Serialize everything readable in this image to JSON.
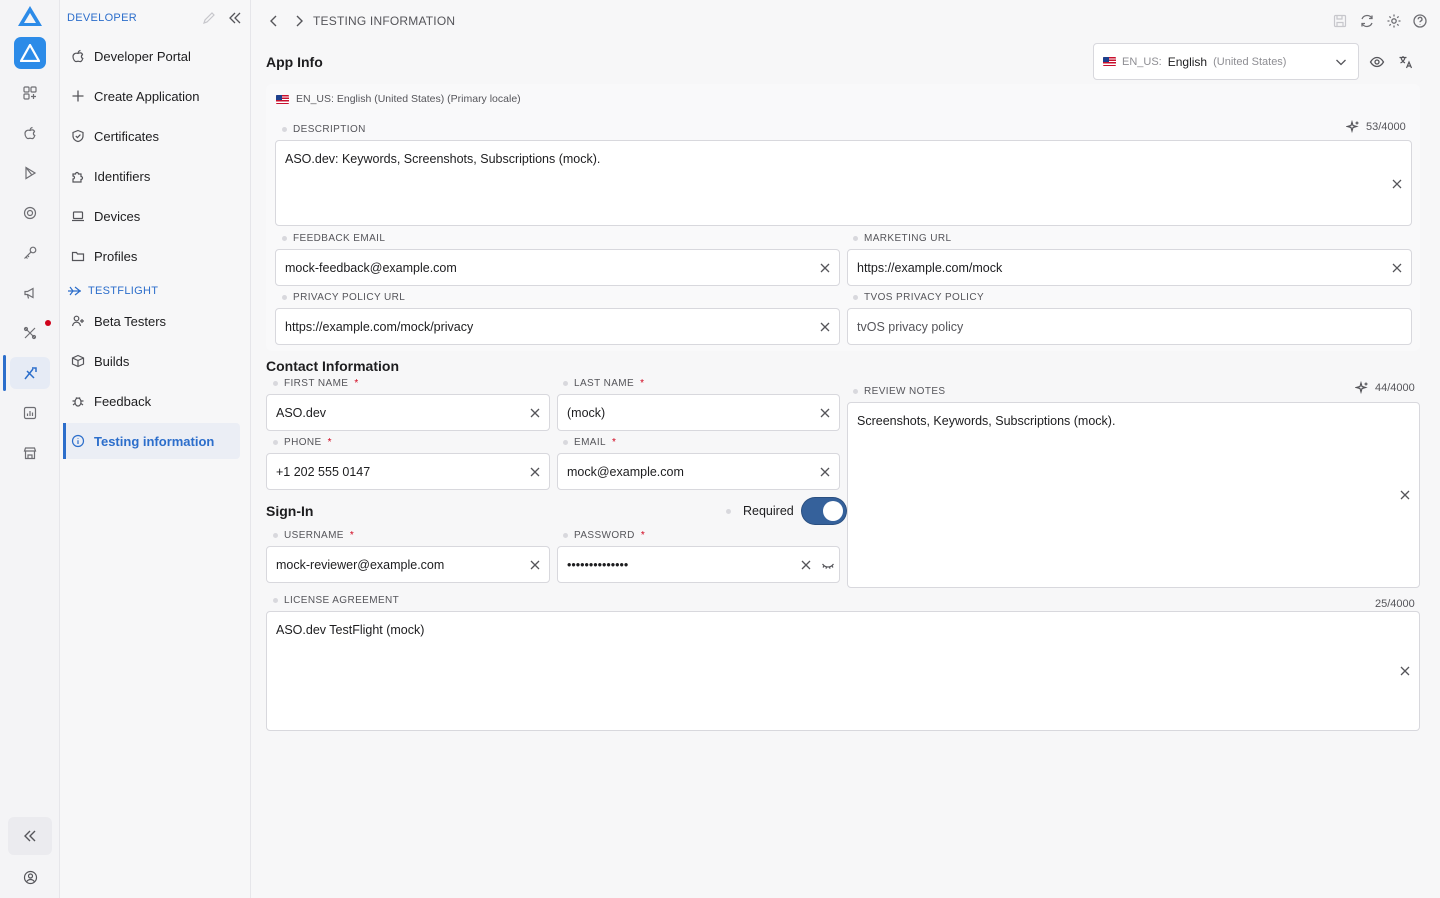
{
  "rail": {
    "items": [
      {
        "icon": "apps-grid-icon"
      },
      {
        "icon": "apple-icon"
      },
      {
        "icon": "play-store-icon"
      },
      {
        "icon": "target-icon"
      },
      {
        "icon": "key-icon"
      },
      {
        "icon": "megaphone-icon"
      },
      {
        "icon": "tools-icon"
      },
      {
        "icon": "xcode-icon"
      },
      {
        "icon": "analytics-icon"
      },
      {
        "icon": "store-icon"
      }
    ],
    "bottom": [
      {
        "icon": "collapse-double-chevron-icon"
      },
      {
        "icon": "account-circle-icon"
      }
    ]
  },
  "sidebar": {
    "section_developer": "DEVELOPER",
    "section_testflight": "TESTFLIGHT",
    "items": [
      {
        "label": "Developer Portal",
        "icon": "apple-outline-icon"
      },
      {
        "label": "Create Application",
        "icon": "plus-icon"
      },
      {
        "label": "Certificates",
        "icon": "shield-check-icon"
      },
      {
        "label": "Identifiers",
        "icon": "puzzle-icon"
      },
      {
        "label": "Devices",
        "icon": "laptop-icon"
      },
      {
        "label": "Profiles",
        "icon": "folder-icon"
      }
    ],
    "testflight_items": [
      {
        "label": "Beta Testers",
        "icon": "user-add-icon"
      },
      {
        "label": "Builds",
        "icon": "box-icon"
      },
      {
        "label": "Feedback",
        "icon": "bug-icon"
      },
      {
        "label": "Testing information",
        "icon": "info-icon",
        "active": true
      }
    ]
  },
  "topbar": {
    "title": "TESTING INFORMATION"
  },
  "app_info": {
    "heading": "App Info",
    "locale_select": {
      "code": "EN_US:",
      "language": "English",
      "region": "(United States)"
    },
    "locale_caption": "EN_US: English (United States) (Primary locale)",
    "description": {
      "label": "DESCRIPTION",
      "counter": "53/4000",
      "value": "ASO.dev: Keywords, Screenshots, Subscriptions (mock)."
    },
    "feedback_email": {
      "label": "FEEDBACK EMAIL",
      "value": "mock-feedback@example.com"
    },
    "marketing_url": {
      "label": "MARKETING URL",
      "value": "https://example.com/mock"
    },
    "privacy_policy_url": {
      "label": "PRIVACY POLICY URL",
      "value": "https://example.com/mock/privacy"
    },
    "tvos_privacy_policy": {
      "label": "TVOS PRIVACY POLICY",
      "placeholder": "tvOS privacy policy"
    }
  },
  "contact": {
    "heading": "Contact Information",
    "first_name": {
      "label": "FIRST NAME",
      "value": "ASO.dev"
    },
    "last_name": {
      "label": "LAST NAME",
      "value": "(mock)"
    },
    "phone": {
      "label": "PHONE",
      "value": "+1 202 555 0147"
    },
    "email": {
      "label": "EMAIL",
      "value": "mock@example.com"
    },
    "review_notes": {
      "label": "REVIEW NOTES",
      "counter": "44/4000",
      "value": "Screenshots, Keywords, Subscriptions (mock)."
    },
    "required_mark": "*"
  },
  "signin": {
    "heading": "Sign-In",
    "required_label": "Required",
    "required_on": true,
    "username": {
      "label": "USERNAME",
      "value": "mock-reviewer@example.com"
    },
    "password": {
      "label": "PASSWORD",
      "value": "••••••••••••••"
    }
  },
  "license": {
    "label": "LICENSE AGREEMENT",
    "counter": "25/4000",
    "value": "ASO.dev TestFlight (mock)"
  },
  "colors": {
    "accent": "#2c6ecb",
    "toggle": "#35619b",
    "required": "#d0021b",
    "brand_blue": "#2c8be8"
  }
}
